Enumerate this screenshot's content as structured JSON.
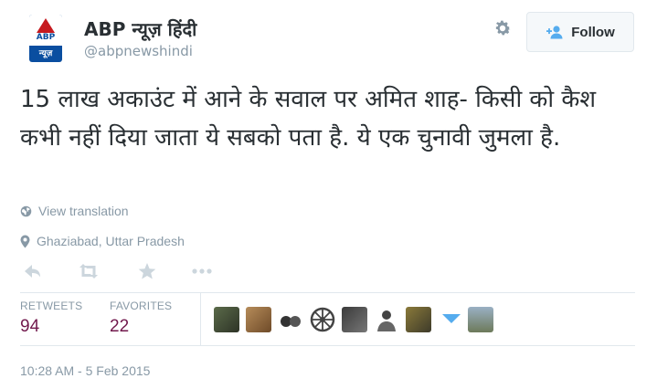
{
  "account": {
    "name": "ABP न्यूज़ हिंदी",
    "handle": "@abpnewshindi",
    "avatar_text_top": "ABP",
    "avatar_text_bottom": "न्यूज़"
  },
  "follow_button": {
    "label": "Follow"
  },
  "tweet": {
    "text": "15 लाख अकाउंट में आने के सवाल पर अमित शाह- किसी को कैश कभी नहीं दिया जाता ये सबको पता है. ये एक चुनावी जुमला है.",
    "translate_label": "View translation",
    "location": "Ghaziabad, Uttar Pradesh",
    "timestamp": "10:28 AM - 5 Feb 2015"
  },
  "stats": {
    "retweets_label": "RETWEETS",
    "retweets_count": "94",
    "favorites_label": "FAVORITES",
    "favorites_count": "22"
  },
  "colors": {
    "link": "#55acee",
    "count": "#71184c",
    "muted": "#8899a6",
    "text": "#292f33"
  },
  "icons": {
    "settings": "gear-icon",
    "follow": "add-user-icon",
    "reply": "reply-icon",
    "retweet": "retweet-icon",
    "favorite": "star-icon",
    "more": "more-icon",
    "translate": "globe-icon",
    "location": "location-pin-icon"
  }
}
